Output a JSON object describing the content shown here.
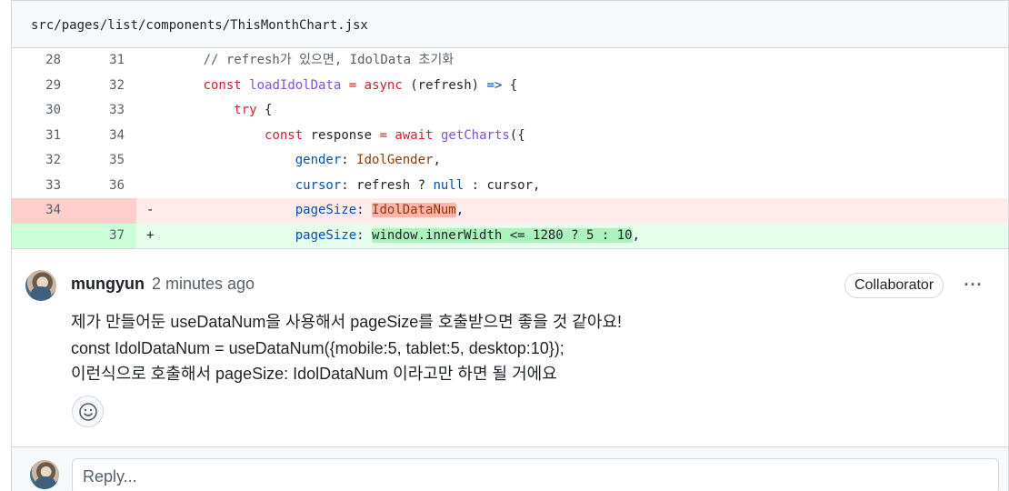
{
  "file": {
    "path": "src/pages/list/components/ThisMonthChart.jsx"
  },
  "diff": {
    "rows": [
      {
        "type": "ctx",
        "old": "28",
        "new": "31",
        "marker": "",
        "tokens": [
          {
            "t": "      ",
            "c": "plain"
          },
          {
            "t": "// refresh가 있으면, IdolData 초기화",
            "c": "comment"
          }
        ]
      },
      {
        "type": "ctx",
        "old": "29",
        "new": "32",
        "marker": "",
        "tokens": [
          {
            "t": "      ",
            "c": "plain"
          },
          {
            "t": "const",
            "c": "kw"
          },
          {
            "t": " ",
            "c": "plain"
          },
          {
            "t": "loadIdolData",
            "c": "fn"
          },
          {
            "t": " ",
            "c": "plain"
          },
          {
            "t": "=",
            "c": "kw"
          },
          {
            "t": " ",
            "c": "plain"
          },
          {
            "t": "async",
            "c": "kw"
          },
          {
            "t": " (refresh) ",
            "c": "plain"
          },
          {
            "t": "=>",
            "c": "prop"
          },
          {
            "t": " {",
            "c": "plain"
          }
        ]
      },
      {
        "type": "ctx",
        "old": "30",
        "new": "33",
        "marker": "",
        "tokens": [
          {
            "t": "          ",
            "c": "plain"
          },
          {
            "t": "try",
            "c": "kw"
          },
          {
            "t": " {",
            "c": "plain"
          }
        ]
      },
      {
        "type": "ctx",
        "old": "31",
        "new": "34",
        "marker": "",
        "tokens": [
          {
            "t": "              ",
            "c": "plain"
          },
          {
            "t": "const",
            "c": "kw"
          },
          {
            "t": " response ",
            "c": "plain"
          },
          {
            "t": "=",
            "c": "kw"
          },
          {
            "t": " ",
            "c": "plain"
          },
          {
            "t": "await",
            "c": "kw"
          },
          {
            "t": " ",
            "c": "plain"
          },
          {
            "t": "getCharts",
            "c": "fn"
          },
          {
            "t": "({",
            "c": "plain"
          }
        ]
      },
      {
        "type": "ctx",
        "old": "32",
        "new": "35",
        "marker": "",
        "tokens": [
          {
            "t": "                  ",
            "c": "plain"
          },
          {
            "t": "gender",
            "c": "prop"
          },
          {
            "t": ": ",
            "c": "plain"
          },
          {
            "t": "IdolGender",
            "c": "var"
          },
          {
            "t": ",",
            "c": "plain"
          }
        ]
      },
      {
        "type": "ctx",
        "old": "33",
        "new": "36",
        "marker": "",
        "tokens": [
          {
            "t": "                  ",
            "c": "plain"
          },
          {
            "t": "cursor",
            "c": "prop"
          },
          {
            "t": ": refresh ? ",
            "c": "plain"
          },
          {
            "t": "null",
            "c": "prop"
          },
          {
            "t": " : cursor,",
            "c": "plain"
          }
        ]
      },
      {
        "type": "del",
        "old": "34",
        "new": "",
        "marker": "-",
        "tokens": [
          {
            "t": "                  ",
            "c": "plain"
          },
          {
            "t": "pageSize",
            "c": "prop"
          },
          {
            "t": ": ",
            "c": "plain"
          },
          {
            "t": "IdolDataNum",
            "c": "var",
            "hl": "del"
          },
          {
            "t": ",",
            "c": "plain"
          }
        ]
      },
      {
        "type": "add",
        "old": "",
        "new": "37",
        "marker": "+",
        "tokens": [
          {
            "t": "                  ",
            "c": "plain"
          },
          {
            "t": "pageSize",
            "c": "prop"
          },
          {
            "t": ": ",
            "c": "plain"
          },
          {
            "t": "window.innerWidth <= 1280 ? 5 : 10",
            "c": "plain",
            "hl": "add"
          },
          {
            "t": ",",
            "c": "plain"
          }
        ]
      }
    ]
  },
  "comment": {
    "author": "mungyun",
    "time": "2 minutes ago",
    "role": "Collaborator",
    "more_icon": "kebab-horizontal-icon",
    "lines": [
      "제가 만들어둔 useDataNum을 사용해서 pageSize를 호출받으면 좋을 것 같아요!",
      "const IdolDataNum = useDataNum({mobile:5, tablet:5, desktop:10});",
      "이런식으로 호출해서 pageSize: IdolDataNum 이라고만 하면 될 거에요"
    ],
    "reaction_icon": "smiley-icon"
  },
  "reply": {
    "placeholder": "Reply..."
  },
  "colors": {
    "deletion_bg": "#ffebe9",
    "addition_bg": "#e6ffec",
    "deletion_hl": "#ffb3ad",
    "addition_hl": "#abf2bc"
  }
}
